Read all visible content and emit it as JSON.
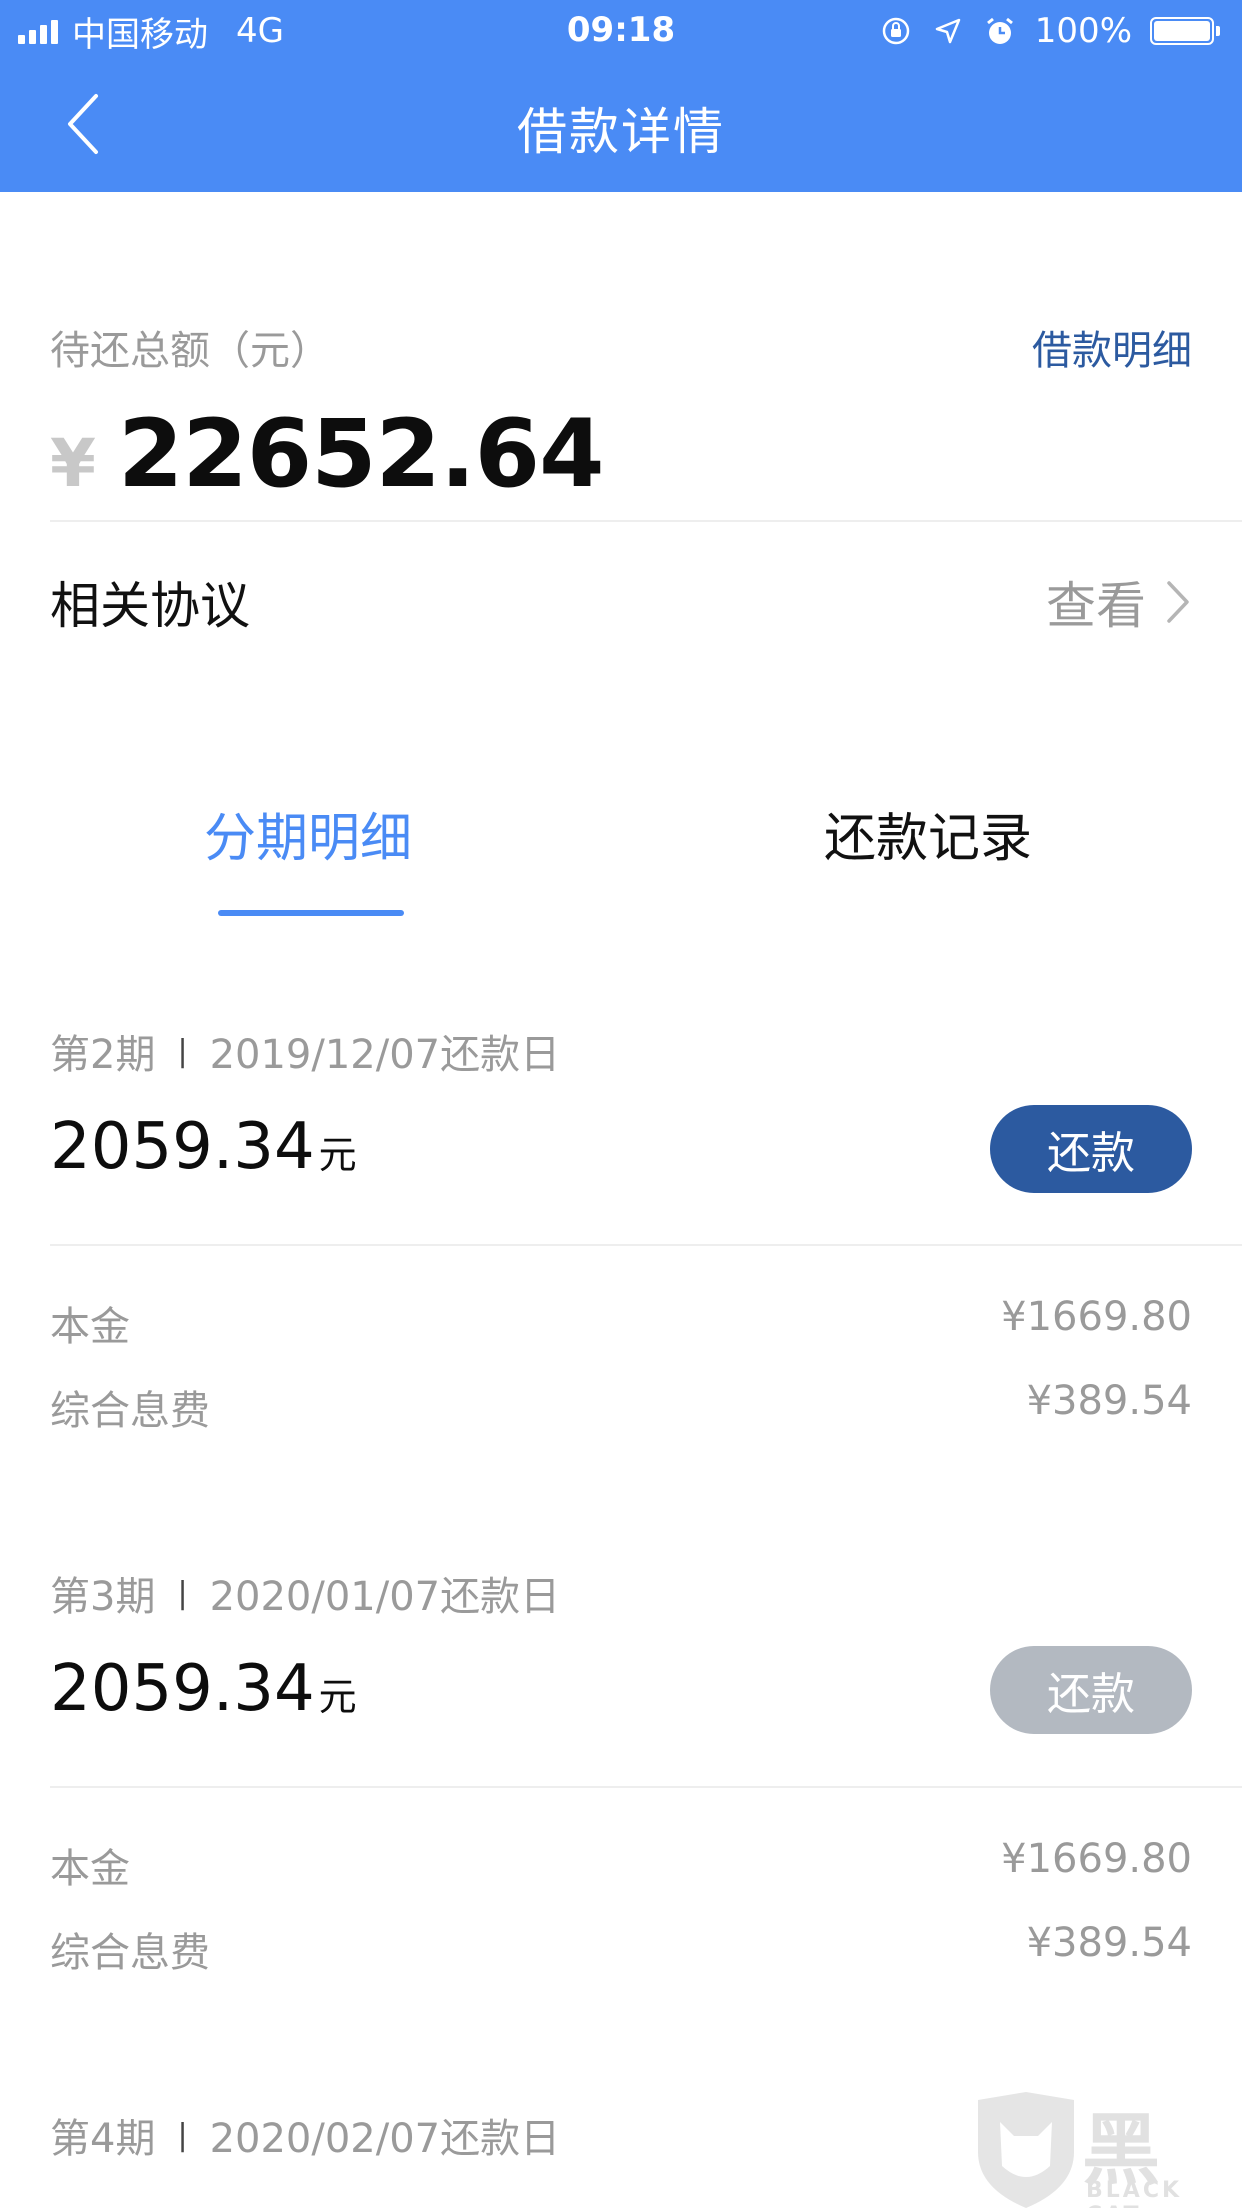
{
  "status_bar": {
    "carrier": "中国移动",
    "network": "4G",
    "time": "09:18",
    "battery": "100%",
    "icons": [
      "signal-icon",
      "rotation-lock-icon",
      "location-icon",
      "alarm-icon",
      "battery-icon"
    ]
  },
  "nav": {
    "title": "借款详情",
    "back_icon": "chevron-left-icon"
  },
  "summary": {
    "label": "待还总额（元）",
    "detail_link": "借款明细",
    "currency": "¥",
    "amount": "22652.64"
  },
  "agreement": {
    "label": "相关协议",
    "action": "查看"
  },
  "tabs": [
    {
      "label": "分期明细",
      "active": true
    },
    {
      "label": "还款记录",
      "active": false
    }
  ],
  "installments": [
    {
      "period": "第2期",
      "separator": "|",
      "date": "2019/12/07还款日",
      "amount": "2059.34",
      "unit": "元",
      "button": "还款",
      "button_enabled": true,
      "principal_label": "本金",
      "principal": "¥1669.80",
      "fee_label": "综合息费",
      "fee": "¥389.54"
    },
    {
      "period": "第3期",
      "separator": "|",
      "date": "2020/01/07还款日",
      "amount": "2059.34",
      "unit": "元",
      "button": "还款",
      "button_enabled": false,
      "principal_label": "本金",
      "principal": "¥1669.80",
      "fee_label": "综合息费",
      "fee": "¥389.54"
    },
    {
      "period": "第4期",
      "separator": "|",
      "date": "2020/02/07还款日"
    }
  ],
  "watermark": {
    "text": "黑猫",
    "sub": "BLACK CAT"
  },
  "colors": {
    "header_blue": "#4a8bf5",
    "link_blue": "#2c5aa0",
    "button_primary": "#2c5aa0",
    "button_disabled": "#b3b9c1",
    "muted_text": "#9a9a9a"
  }
}
